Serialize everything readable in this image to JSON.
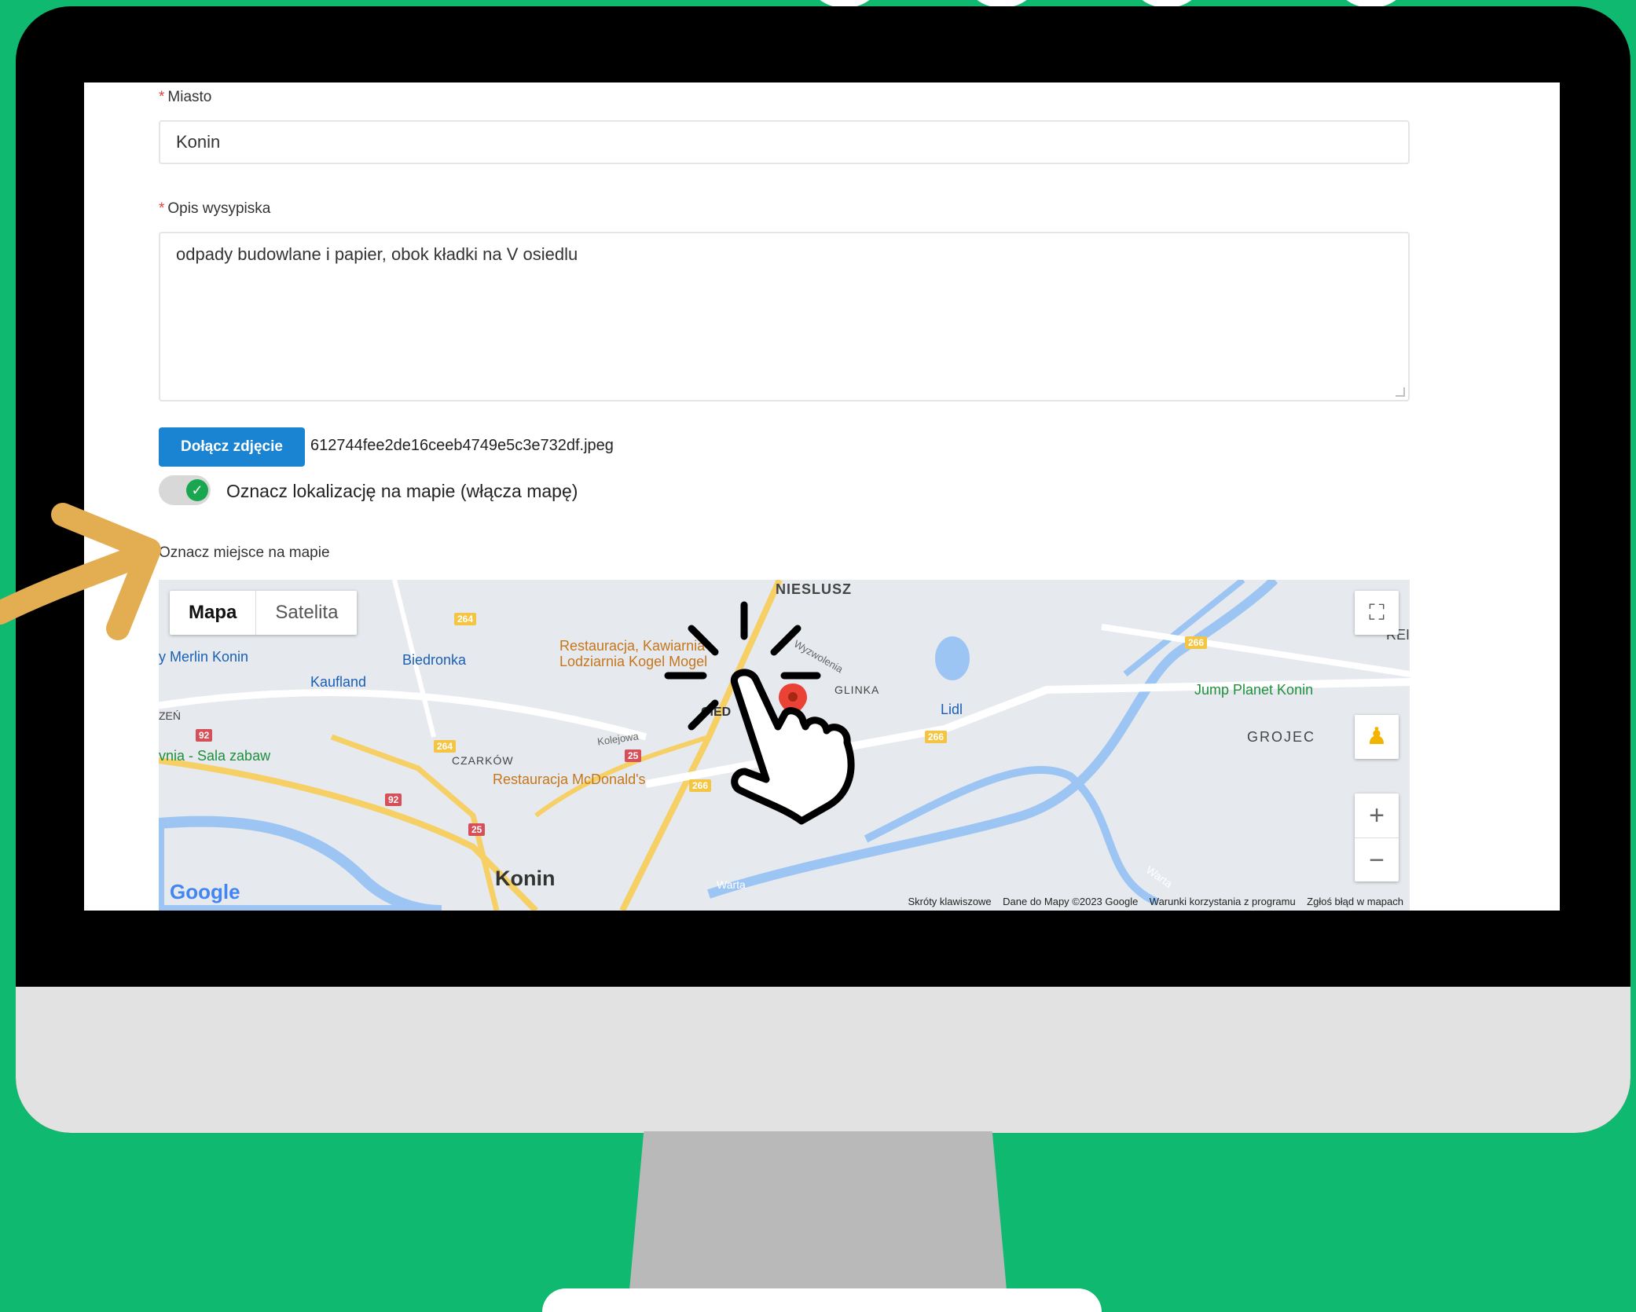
{
  "form": {
    "city_label": "Miasto",
    "city_value": "Konin",
    "desc_label": "Opis wysypiska",
    "desc_value": "odpady budowlane i papier, obok kładki na V osiedlu",
    "required_mark": "*",
    "upload_button": "Dołącz zdjęcie",
    "uploaded_filename": "612744fee2de16ceeb4749e5c3e732df.jpeg",
    "toggle_label": "Oznacz lokalizację na mapie (włącza mapę)",
    "toggle_checked": true,
    "map_label": "Oznacz miejsce na mapie"
  },
  "map": {
    "type_map": "Mapa",
    "type_satellite": "Satelita",
    "zoom_in": "+",
    "zoom_out": "−",
    "logo": "Google",
    "attribution": [
      "Skróty klawiszowe",
      "Dane do Mapy ©2023 Google",
      "Warunki korzystania z programu",
      "Zgłoś błąd w mapach"
    ],
    "places": {
      "nieslusz": "NIESLUSZ",
      "merlin": "y Merlin Konin",
      "biedronka": "Biedronka",
      "kaufland": "Kaufland",
      "restauracja1": "Restauracja, Kawiarnia",
      "restauracja1b": "Lodziarnia Kogel Mogel",
      "glinka": "GLINKA",
      "lidl": "Lidl",
      "jump": "Jump Planet Konin",
      "grojec": "GROJEC",
      "zen": "ZEŃ",
      "sala": "vnia - Sala zabaw",
      "czarkow": "CZARKÓW",
      "mcdonalds": "Restauracja McDonald's",
      "konin": "Konin",
      "warta1": "Warta",
      "warta2": "Warta",
      "kolejowa": "Kolejowa",
      "wyzwolenia": "Wyzwolenia",
      "centrum": "CIED",
      "rei": "REI"
    },
    "roads": [
      "264",
      "264",
      "92",
      "92",
      "25",
      "25",
      "266",
      "266",
      "266"
    ]
  },
  "colors": {
    "background": "#0fb96f",
    "button": "#1a84d2",
    "toggle_on": "#18a64f",
    "arrow": "#e3ae52"
  }
}
